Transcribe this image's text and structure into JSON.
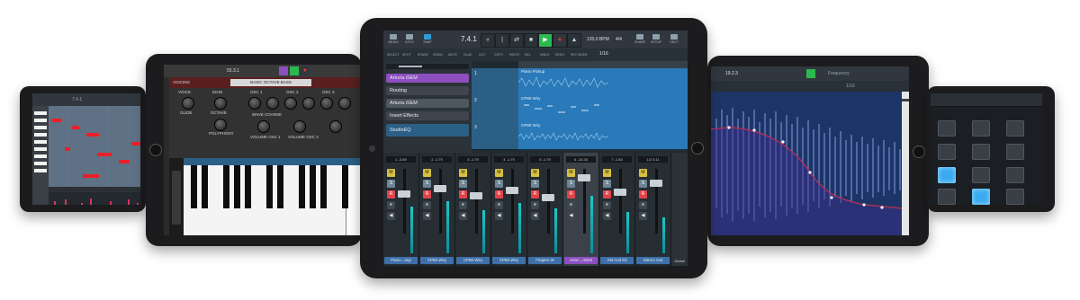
{
  "center": {
    "toolbar": [
      {
        "icon": "media-icon",
        "label": "MEDIA"
      },
      {
        "icon": "keys-icon",
        "label": "KEYS"
      },
      {
        "icon": "snap-icon",
        "label": "SNAP"
      }
    ],
    "position": "7.4.1",
    "tempo": "120.0 BPM",
    "signature": "4/4",
    "right_buttons": [
      {
        "icon": "share-icon",
        "label": "SHARE"
      },
      {
        "icon": "setup-icon",
        "label": "SETUP"
      },
      {
        "icon": "help-icon",
        "label": "HELP"
      }
    ],
    "tools": [
      "SELECT",
      "SPLIT",
      "ERASE",
      "DRAW",
      "MUTE",
      "GLUE",
      "CUT",
      "COPY",
      "PASTE",
      "DEL",
      "UNDO",
      "REDO",
      "REC MODE"
    ],
    "quantize": "1/16",
    "inspector": {
      "instrument": "Arturia iSEM",
      "routing": "Routing",
      "input": "Arturia iSEM",
      "inserts": "Insert Effects",
      "plugin": "StudioEQ"
    },
    "tracks": [
      {
        "number": "1",
        "name": "Piano Pickup"
      },
      {
        "number": "2",
        "name": "CP80 Wiry"
      },
      {
        "number": "3",
        "name": "CP80 Wiry"
      }
    ],
    "mixer": [
      {
        "number": "1",
        "pan": "-3.89",
        "name": "Piano...dup"
      },
      {
        "number": "2",
        "pan": "-1.79",
        "name": "CP80 Wiry"
      },
      {
        "number": "3",
        "pan": "-1.79",
        "name": "CP80 Wiry"
      },
      {
        "number": "4",
        "pan": "-1.79",
        "name": "CP80 Wiry"
      },
      {
        "number": "5",
        "pan": "-1.79",
        "name": "Fingers W"
      },
      {
        "number": "6",
        "pan": "-10.28",
        "name": "Arturi...iSEM"
      },
      {
        "number": "7",
        "pan": "-1.83",
        "name": "AM And Kit"
      },
      {
        "number": "1/2",
        "pan": "3.11",
        "name": "Stereo Out"
      }
    ],
    "global": "Global"
  },
  "left": {
    "position": "55.3.1",
    "preset_tab": "VOICING",
    "preset": "BASIC OCTAVE BASS",
    "sections": [
      "VOICE",
      "MAIN",
      "OSC 1",
      "OSC 2",
      "OSC 3"
    ],
    "labels": [
      "GLIDE",
      "OCTAVE",
      "POLYPHONY",
      "WAVE",
      "COARSE",
      "VOLUME OSC 1",
      "VOLUME OSC 2"
    ]
  },
  "far_left": {
    "position": "7.4.1"
  },
  "right": {
    "position": "19.2.3",
    "label": "Frequency",
    "quantize": "1/16"
  },
  "colors": {
    "accent": "#2f9ad8",
    "play": "#2db84f",
    "record": "#e53935",
    "instrument_track": "#8d4fc0",
    "track_lane": "#2a79b8"
  }
}
